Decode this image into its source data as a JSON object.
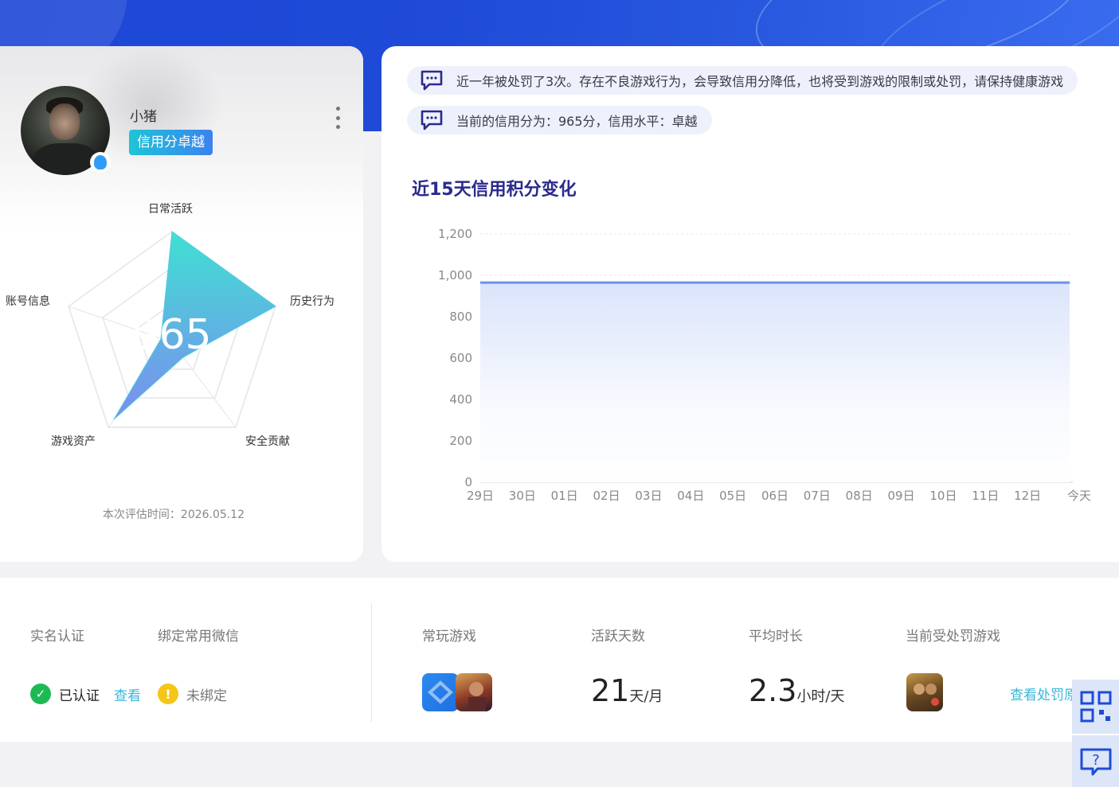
{
  "profile": {
    "nickname": "小猪",
    "credit_tag": "信用分卓越",
    "score": "965",
    "radar_labels": {
      "top": "日常活跃",
      "right": "历史行为",
      "bottom_right": "安全贡献",
      "bottom_left": "游戏资产",
      "left": "账号信息"
    },
    "eval_time": "本次评估时间：2026.05.12"
  },
  "notices": [
    "近一年被处罚了3次。存在不良游戏行为，会导致信用分降低，也将受到游戏的限制或处罚，请保持健康游戏",
    "当前的信用分为：965分，信用水平：卓越"
  ],
  "chart_title": "近15天信用积分变化",
  "chart_data": {
    "type": "area",
    "title": "近15天信用积分变化",
    "categories": [
      "29日",
      "30日",
      "01日",
      "02日",
      "03日",
      "04日",
      "05日",
      "06日",
      "07日",
      "08日",
      "09日",
      "10日",
      "11日",
      "12日",
      "今天"
    ],
    "values": [
      965,
      965,
      965,
      965,
      965,
      965,
      965,
      965,
      965,
      965,
      965,
      965,
      965,
      965,
      965
    ],
    "yticks": [
      "0",
      "200",
      "400",
      "600",
      "800",
      "1,000",
      "1,200"
    ],
    "ylim": [
      0,
      1200
    ],
    "grid": true,
    "color": "#6a93ea"
  },
  "bottom": {
    "realname_label": "实名认证",
    "wechat_label": "绑定常用微信",
    "realname_status": "已认证",
    "realname_link": "查看",
    "wechat_status": "未绑定",
    "games_label": "常玩游戏",
    "active_label": "活跃天数",
    "active_value": "21",
    "active_unit": "天/月",
    "avg_label": "平均时长",
    "avg_value": "2.3",
    "avg_unit": "小时/天",
    "punished_label": "当前受处罚游戏",
    "punish_link": "查看处罚原"
  }
}
